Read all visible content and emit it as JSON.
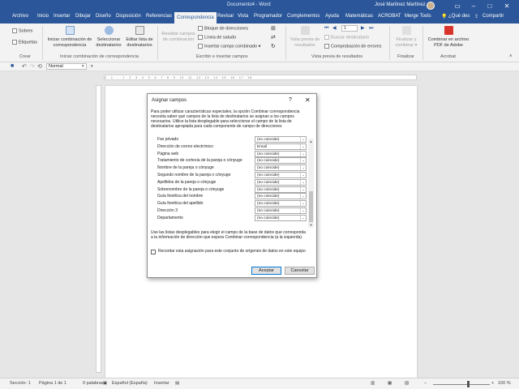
{
  "window": {
    "title": "Documento4 - Word",
    "user": "José Martínez Martínez"
  },
  "tabs": [
    "Archivo",
    "Inicio",
    "Insertar",
    "Dibujar",
    "Diseño",
    "Disposición",
    "Referencias",
    "Correspondencia",
    "Revisar",
    "Vista",
    "Programador",
    "Complementos",
    "Ayuda",
    "Matemáticas",
    "ACROBAT",
    "Merge Tools"
  ],
  "active_tab": "Correspondencia",
  "tell_me": "¿Qué des",
  "share": "Compartir",
  "ribbon": {
    "crear": {
      "group": "Crear",
      "sobres": "Sobres",
      "etiquetas": "Etiquetas"
    },
    "iniciar": {
      "group": "Iniciar combinación de correspondencia",
      "iniciar_label": "Iniciar combinación de correspondencia",
      "seleccionar_label": "Seleccionar destinatarios",
      "editar_label": "Editar lista de destinatarios"
    },
    "escribir": {
      "group": "Escribir e insertar campos",
      "resaltar": "Resaltar campos de combinación",
      "bloque": "Bloque de direcciones",
      "linea": "Línea de saludo",
      "insertar": "Insertar campo combinado"
    },
    "vista_previa": {
      "group": "Vista previa de resultados",
      "vista_label": "Vista previa de resultados",
      "record": "1",
      "buscar": "Buscar destinatario",
      "comprobacion": "Comprobación de errores"
    },
    "finalizar": {
      "group": "Finalizar",
      "finalizar_label": "Finalizar y combinar"
    },
    "acrobat": {
      "group": "Acrobat",
      "combinar_label": "Combinar en archivo PDF de Adobe"
    }
  },
  "qat": {
    "style": "Normal"
  },
  "ruler_text": "2 · 1 · · · 1 · 2 · 3 · 4 · 5 · 6 · 7 · 8 · 9 · 10 · 11 · 12 · 13 · 14 · 15 · 16 · 17 · 18",
  "dialog": {
    "title": "Asignar campos",
    "help": "?",
    "close": "✕",
    "intro": "Para poder utilizar características especiales, la opción Combinar correspondencia necesita saber qué campos de la lista de destinatarios se asignan a los campos necesarios. Utilice la lista desplegable para seleccionar el campo de la lista de destinatarios apropiada para cada componente de campo de direcciones",
    "fields": [
      {
        "label": "Fax privado",
        "value": "(no coincide)"
      },
      {
        "label": "Dirección de correo electrónico",
        "value": "Email"
      },
      {
        "label": "Página web",
        "value": "(no coincide)"
      },
      {
        "label": "Tratamiento de cortesía de la pareja o cónyuge",
        "value": "(no coincide)"
      },
      {
        "label": "Nombre de la pareja o cónyuge",
        "value": "(no coincide)"
      },
      {
        "label": "Segundo nombre de la pareja o cónyuge",
        "value": "(no coincide)"
      },
      {
        "label": "Apellidos de la pareja o cónyuge",
        "value": "(no coincide)"
      },
      {
        "label": "Sobrenombre de la pareja o cónyuge",
        "value": "(no coincide)"
      },
      {
        "label": "Guía fonética del nombre",
        "value": "(no coincide)"
      },
      {
        "label": "Guía fonética del apellido",
        "value": "(no coincide)"
      },
      {
        "label": "Dirección 3",
        "value": "(no coincide)"
      },
      {
        "label": "Departamento",
        "value": "(no coincide)"
      }
    ],
    "note": "Use las listas desplegables para elegir el campo de la base de datos que corresponda a la información de dirección que espera Combinar correspondencia (a la izquierda).",
    "remember": "Recordar esta asignación para este conjunto de orígenes de datos en este equipo",
    "remember_checked": false,
    "ok": "Aceptar",
    "cancel": "Cancelar"
  },
  "status": {
    "section": "Sección: 1",
    "page": "Página 1 de 1",
    "words": "0 palabras",
    "language": "Español (España)",
    "mode": "Insertar",
    "zoom": "100 %",
    "zoom_fraction": 0.62
  },
  "colors": {
    "accent": "#2b579a",
    "default_button": "#0078d7"
  }
}
